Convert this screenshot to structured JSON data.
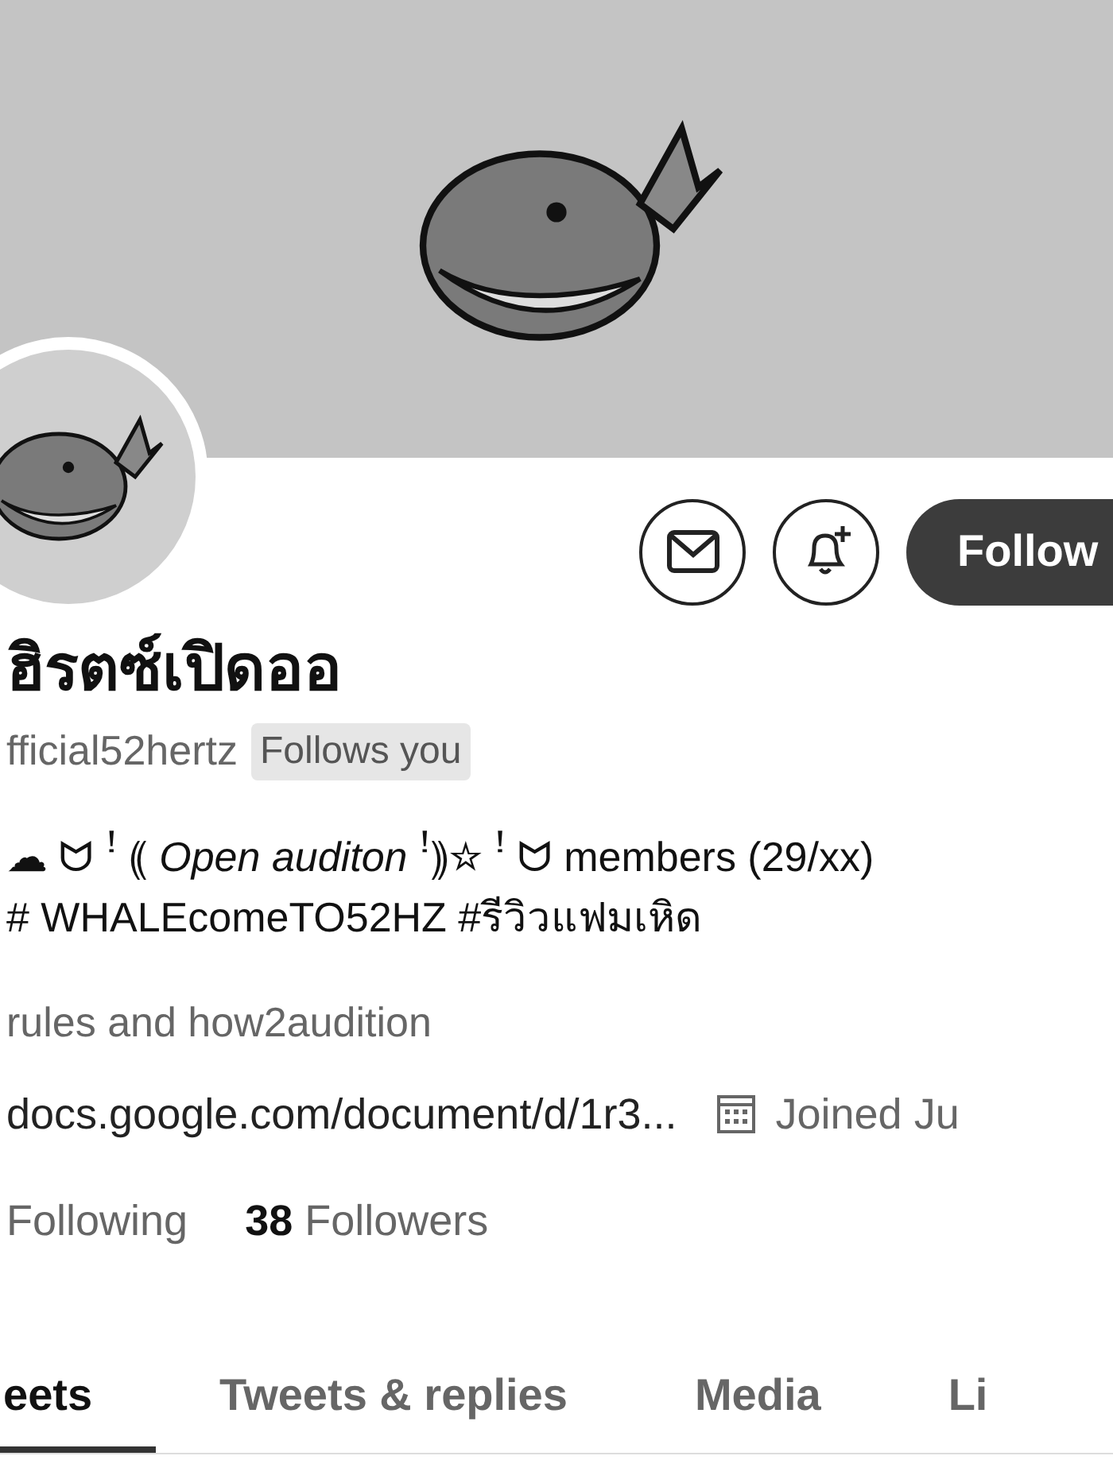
{
  "profile": {
    "name": "ฮิรตซ์เปิดออ",
    "handle": "fficial52hertz",
    "follows_you_badge": "Follows you",
    "bio_lines": [
      "☁ ᗢ ꜝ ⸨ *Open auditon* ꜝ⸩☆ ꜝ ᗢ members (29/xx)",
      "# WHALEcomeTO52HZ #รีวิวแฟมเหิด"
    ],
    "location": "rules and how2audition",
    "link": "docs.google.com/document/d/1r3...",
    "joined": "Joined Ju",
    "following_label": "Following",
    "followers_count": "38",
    "followers_label": "Followers"
  },
  "actions": {
    "follow_button": "Follow"
  },
  "tabs": [
    {
      "label": "eets",
      "selected": true
    },
    {
      "label": "Tweets & replies",
      "selected": false
    },
    {
      "label": "Media",
      "selected": false
    },
    {
      "label": "Li",
      "selected": false
    }
  ]
}
